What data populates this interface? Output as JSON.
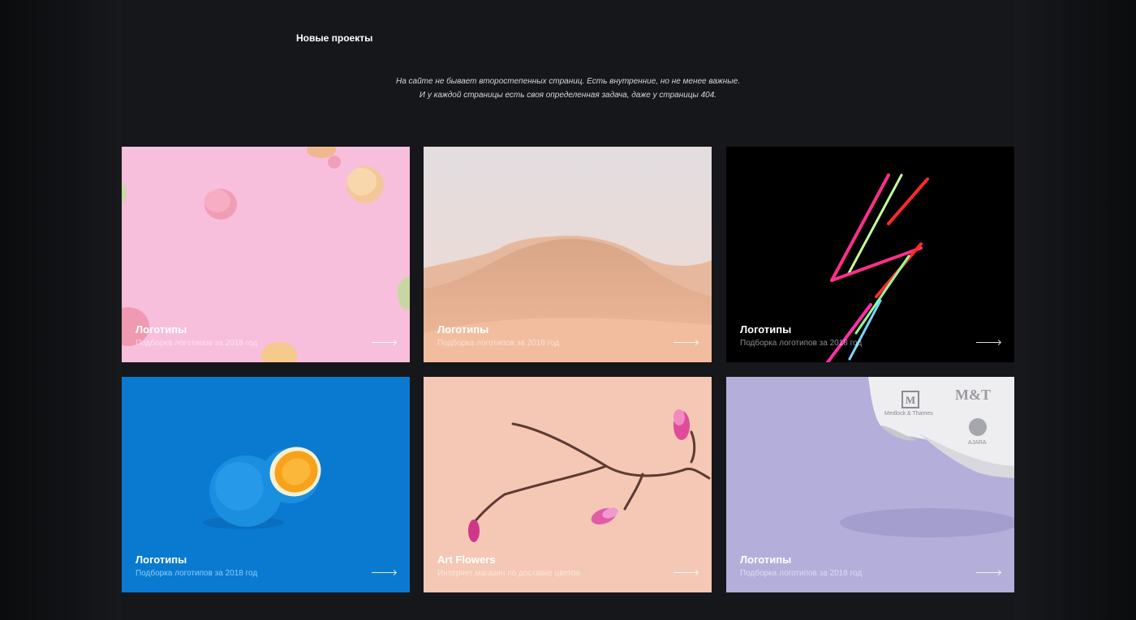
{
  "section": {
    "title": "Новые проекты",
    "intro_line1": "На сайте не бывает второстепенных страниц. Есть внутренние, но не менее важные.",
    "intro_line2": "И у каждой страницы есть своя определенная задача, даже у страницы 404."
  },
  "cards": [
    {
      "title": "Логотипы",
      "subtitle": "Подборка логотипов за 2018 год",
      "bg": "#f7bfdc",
      "theme": "macarons"
    },
    {
      "title": "Логотипы",
      "subtitle": "Подборка логотипов за 2018 год",
      "bg": "#e9d6cf",
      "theme": "desert"
    },
    {
      "title": "Логотипы",
      "subtitle": "Подборка логотипов за 2018 год",
      "bg": "#000000",
      "theme": "neon-bolt"
    },
    {
      "title": "Логотипы",
      "subtitle": "Подборка логотипов за 2018 год",
      "bg": "#0a7ad0",
      "theme": "orange"
    },
    {
      "title": "Art Flowers",
      "subtitle": "Интернет магазин по доставке цветов",
      "bg": "#f4c8b4",
      "theme": "branch"
    },
    {
      "title": "Логотипы",
      "subtitle": "Подборка логотипов за 2018 год",
      "bg": "#b4aedb",
      "theme": "paper-logos"
    }
  ],
  "paper_logos": {
    "logo1": "Medlock & Thames",
    "logo2": "M&T",
    "logo3": "AJARA"
  },
  "icons": {
    "card_arrow": "arrow-right-icon"
  }
}
